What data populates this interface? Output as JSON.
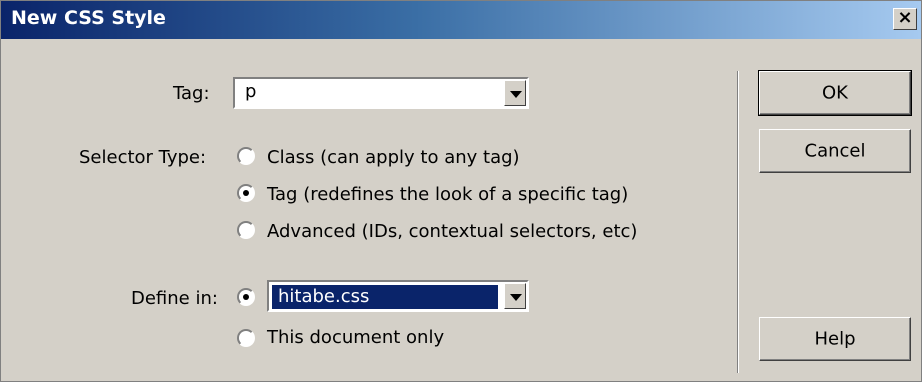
{
  "window": {
    "title": "New CSS Style"
  },
  "tag": {
    "label": "Tag:",
    "value": "p"
  },
  "selector_type": {
    "label": "Selector Type:",
    "options": [
      {
        "label": "Class (can apply to any tag)",
        "selected": false
      },
      {
        "label": "Tag (redefines the look of a specific tag)",
        "selected": true
      },
      {
        "label": "Advanced (IDs, contextual selectors, etc)",
        "selected": false
      }
    ]
  },
  "define_in": {
    "label": "Define in:",
    "file_value": "hitabe.css",
    "file_selected": true,
    "doc_only_label": "This document only",
    "doc_only_selected": false
  },
  "buttons": {
    "ok": "OK",
    "cancel": "Cancel",
    "help": "Help"
  },
  "close_glyph": "×"
}
